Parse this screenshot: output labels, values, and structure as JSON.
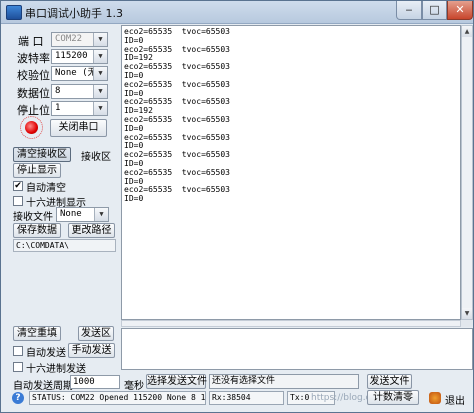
{
  "window": {
    "title": "串口调试小助手 1.3",
    "min": "‒",
    "max": "□",
    "close": "✕"
  },
  "serial": {
    "port_label": "端 口",
    "port_value": "COM22",
    "baud_label": "波特率",
    "baud_value": "115200",
    "parity_label": "校验位",
    "parity_value": "None (无)",
    "databits_label": "数据位",
    "databits_value": "8",
    "stopbits_label": "停止位",
    "stopbits_value": "1",
    "close_port_btn": "关闭串口"
  },
  "receive": {
    "clear_btn": "清空接收区",
    "area_label": "接收区",
    "stop_btn": "停止显示",
    "auto_clear_label": "自动清空",
    "auto_clear_checked": "✔",
    "hex_display_label": "十六进制显示",
    "file_label": "接收文件",
    "file_value": "None",
    "save_btn": "保存数据",
    "change_path_btn": "更改路径",
    "path": "C:\\COMDATA\\",
    "lines": [
      "eco2=65535  tvoc=65503",
      "ID=0",
      "eco2=65535  tvoc=65503",
      "ID=192",
      "eco2=65535  tvoc=65503",
      "ID=0",
      "eco2=65535  tvoc=65503",
      "ID=0",
      "eco2=65535  tvoc=65503",
      "ID=192",
      "eco2=65535  tvoc=65503",
      "ID=0",
      "eco2=65535  tvoc=65503",
      "ID=0",
      "eco2=65535  tvoc=65503",
      "ID=0",
      "eco2=65535  tvoc=65503",
      "ID=0",
      "eco2=65535  tvoc=65503",
      "ID=0"
    ]
  },
  "send": {
    "clear_btn": "清空重填",
    "area_label": "发送区",
    "auto_send_label": "自动发送",
    "manual_send_btn": "手动发送",
    "hex_send_label": "十六进制发送",
    "period_label": "自动发送周期",
    "period_value": "1000",
    "period_unit": "毫秒",
    "select_file_btn": "选择发送文件",
    "file_status": "还没有选择文件",
    "send_file_btn": "发送文件"
  },
  "status": {
    "status_text": "STATUS: COM22 Opened 115200 None  8 1",
    "rx": "Rx:38504",
    "tx": "Tx:0",
    "reset_count_btn": "计数清零",
    "exit_label": "退出",
    "watermark": "https://blog.csdn.net/..."
  }
}
